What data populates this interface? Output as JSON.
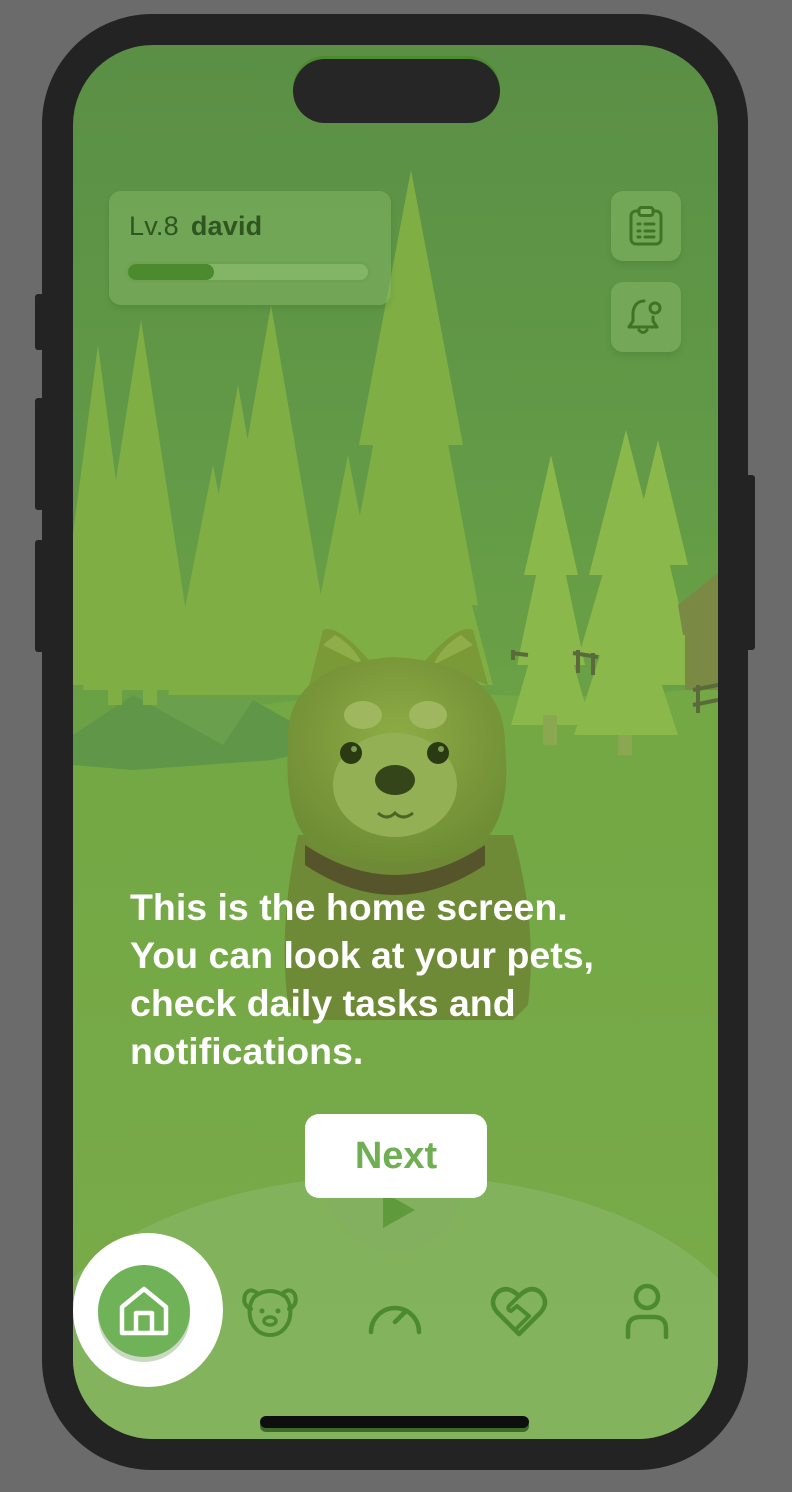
{
  "header": {
    "level_label": "Lv.8",
    "username": "david",
    "xp_progress": 0.36
  },
  "side_buttons": {
    "tasks_icon": "clipboard-icon",
    "notifications_icon": "bell-icon"
  },
  "tutorial": {
    "lines": [
      "This is the home screen.",
      "You can look at your pets,",
      "check daily tasks and",
      "notifications."
    ],
    "next_label": "Next"
  },
  "bottom_nav": {
    "items": [
      {
        "icon": "home-icon",
        "active": true
      },
      {
        "icon": "dog-face-icon",
        "active": false
      },
      {
        "icon": "speedometer-icon",
        "active": false
      },
      {
        "icon": "heart-handshake-icon",
        "active": false
      },
      {
        "icon": "user-icon",
        "active": false
      }
    ],
    "center_icon": "play-icon"
  },
  "colors": {
    "accent": "#6fae53",
    "dark_green": "#4c8a2e",
    "overlay_green": "#6ca245"
  }
}
